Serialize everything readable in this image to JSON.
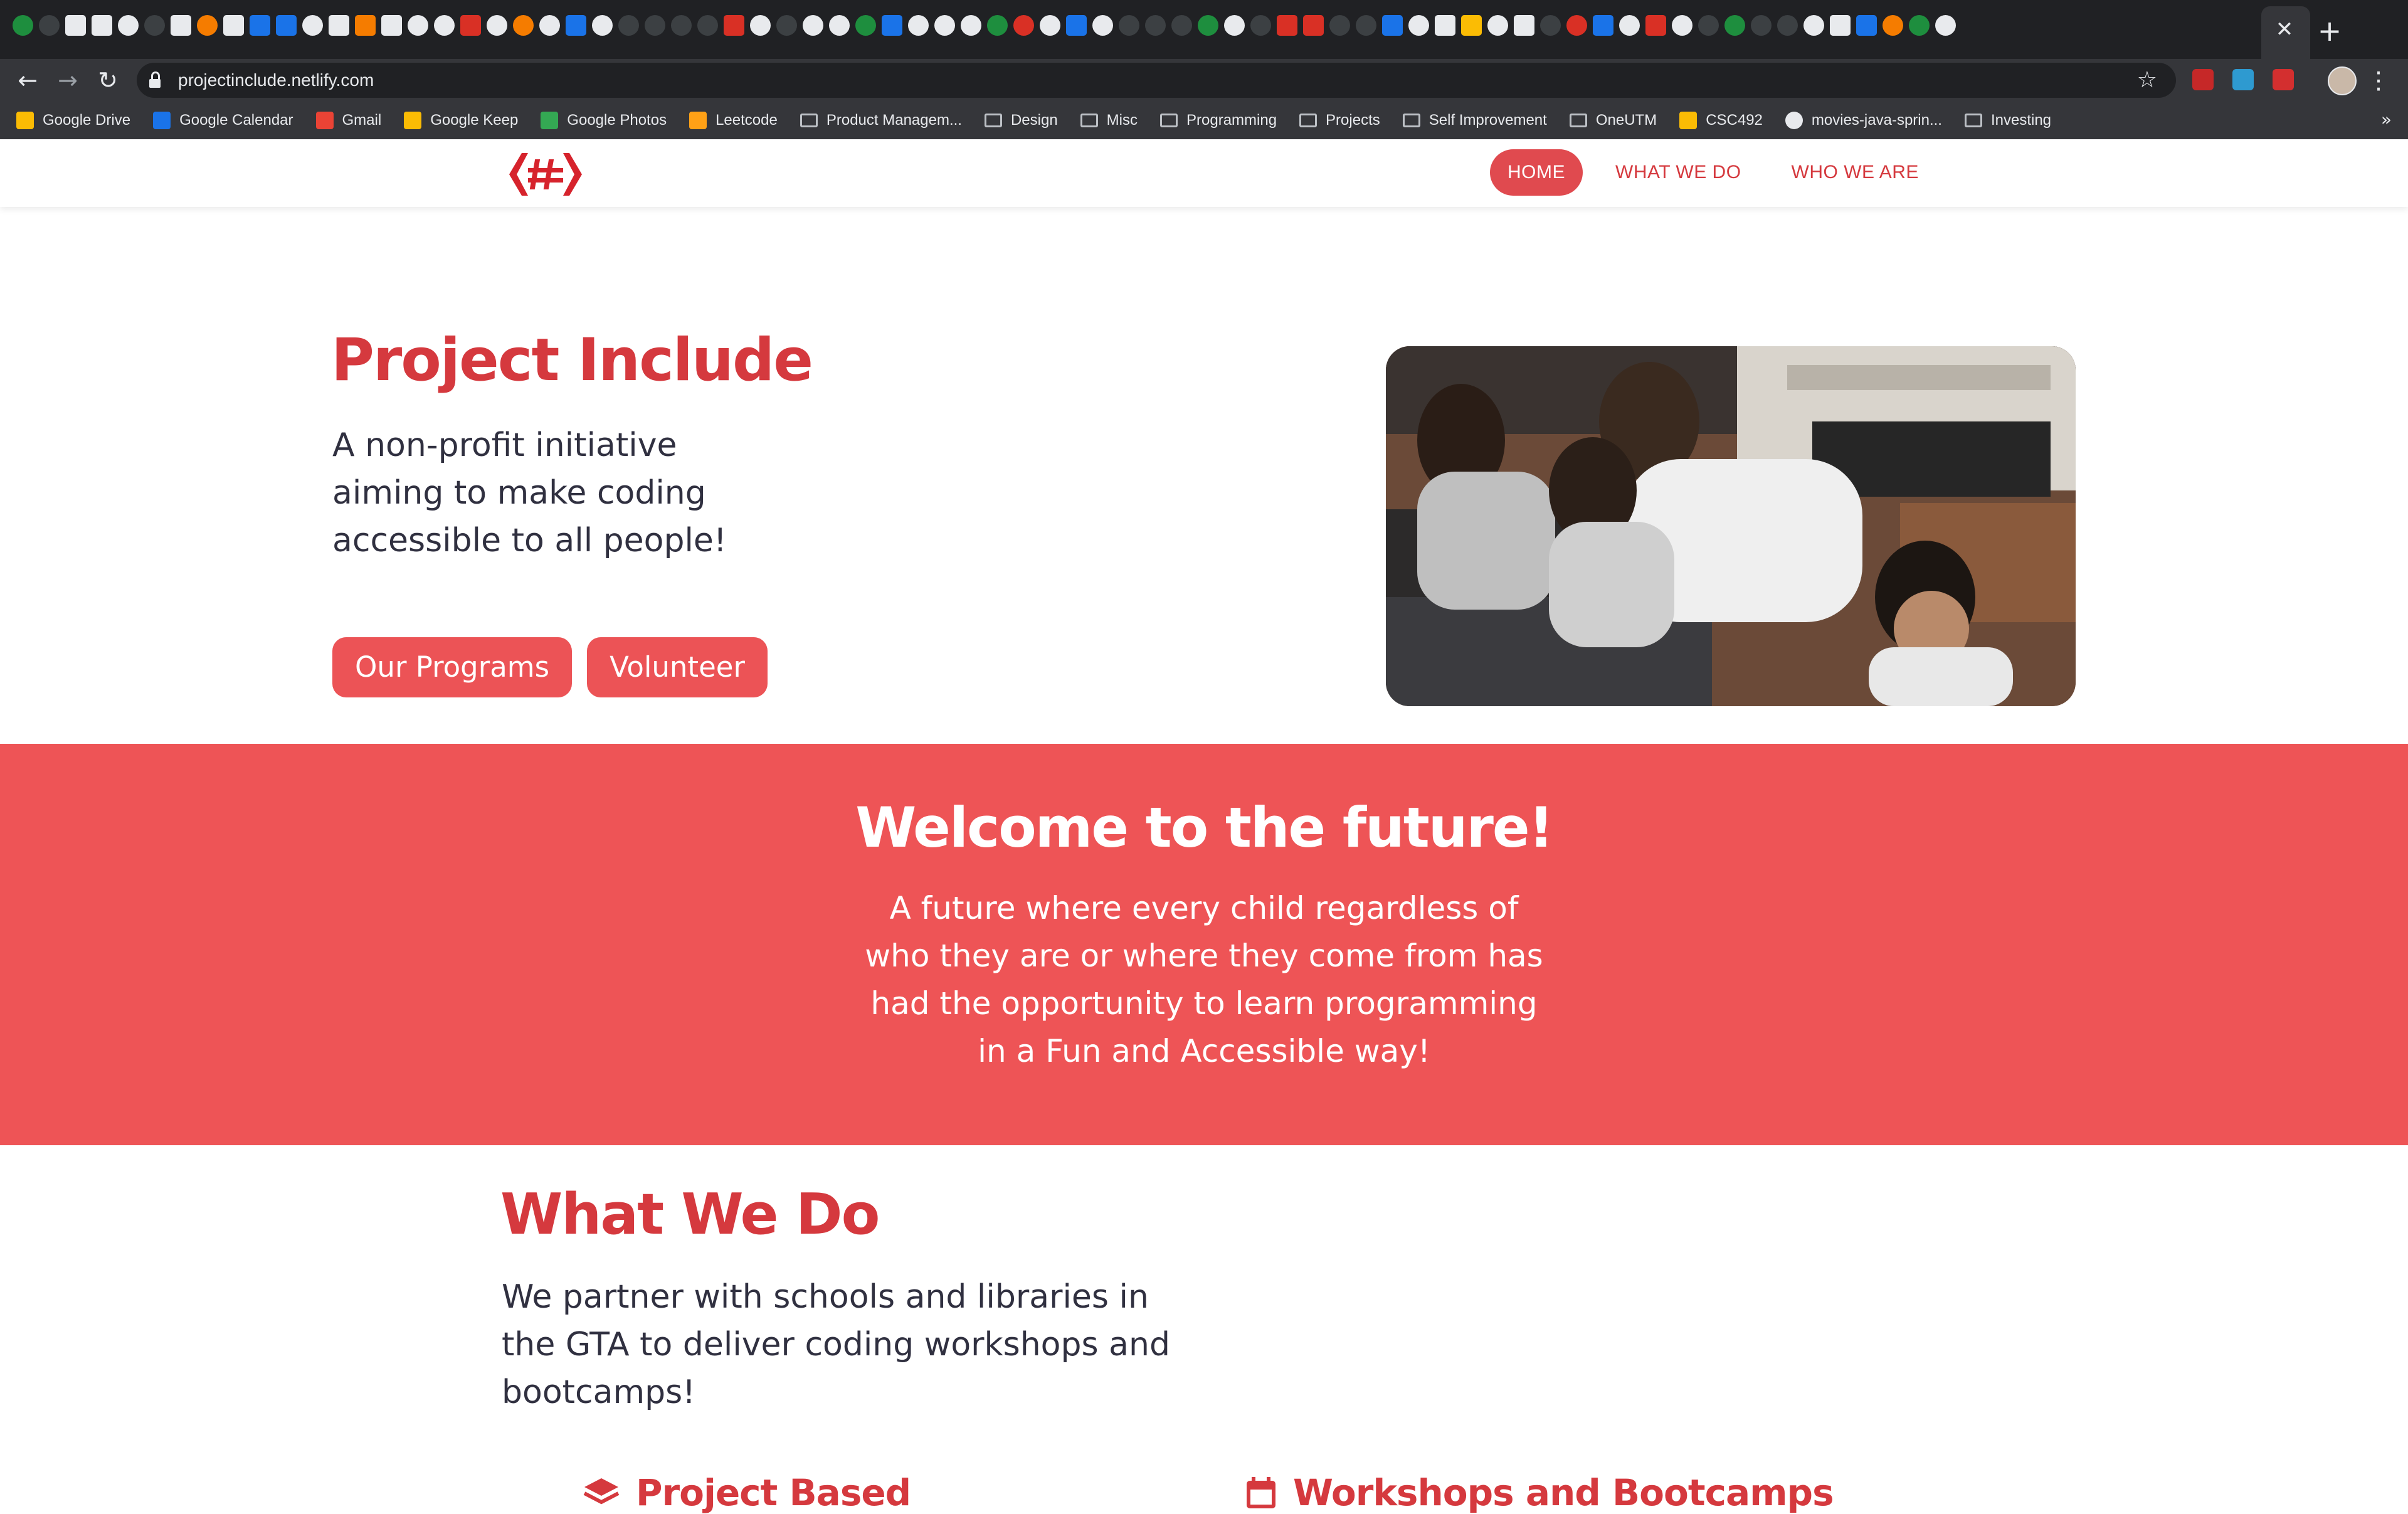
{
  "browser": {
    "url": "projectinclude.netlify.com",
    "bookmarks": [
      {
        "label": "Google Drive",
        "icon": "google-drive-icon"
      },
      {
        "label": "Google Calendar",
        "icon": "google-calendar-icon"
      },
      {
        "label": "Gmail",
        "icon": "gmail-icon"
      },
      {
        "label": "Google Keep",
        "icon": "google-keep-icon"
      },
      {
        "label": "Google Photos",
        "icon": "google-photos-icon"
      },
      {
        "label": "Leetcode",
        "icon": "leetcode-icon"
      },
      {
        "label": "Product Managem...",
        "icon": "folder-icon"
      },
      {
        "label": "Design",
        "icon": "folder-icon"
      },
      {
        "label": "Misc",
        "icon": "folder-icon"
      },
      {
        "label": "Programming",
        "icon": "folder-icon"
      },
      {
        "label": "Projects",
        "icon": "folder-icon"
      },
      {
        "label": "Self Improvement",
        "icon": "folder-icon"
      },
      {
        "label": "OneUTM",
        "icon": "folder-icon"
      },
      {
        "label": "CSC492",
        "icon": "google-drive-icon"
      },
      {
        "label": "movies-java-sprin...",
        "icon": "github-icon"
      },
      {
        "label": "Investing",
        "icon": "folder-icon"
      }
    ],
    "more_label": "»"
  },
  "site": {
    "nav": {
      "items": [
        {
          "label": "HOME"
        },
        {
          "label": "WHAT WE DO"
        },
        {
          "label": "WHO WE ARE"
        }
      ]
    },
    "hero": {
      "title": "Project Include",
      "subtitle": "A non-profit initiative aiming to make coding accessible to all people!",
      "buttons": [
        "Our Programs",
        "Volunteer"
      ]
    },
    "banner": {
      "title": "Welcome to the future!",
      "text": "A future where every child regardless of who they are or where they come from has had the opportunity to learn programming in a Fun and Accessible way!"
    },
    "what_we_do": {
      "title": "What We Do",
      "text": "We partner with schools and libraries in the GTA to deliver coding workshops and bootcamps!",
      "features": [
        {
          "title": "Project Based",
          "icon": "layers-icon"
        },
        {
          "title": "Workshops and Bootcamps",
          "icon": "calendar-icon"
        }
      ]
    }
  },
  "colors": {
    "brand_red": "#d5393e",
    "banner_red": "#ee5456",
    "button_red": "#ec5356"
  }
}
